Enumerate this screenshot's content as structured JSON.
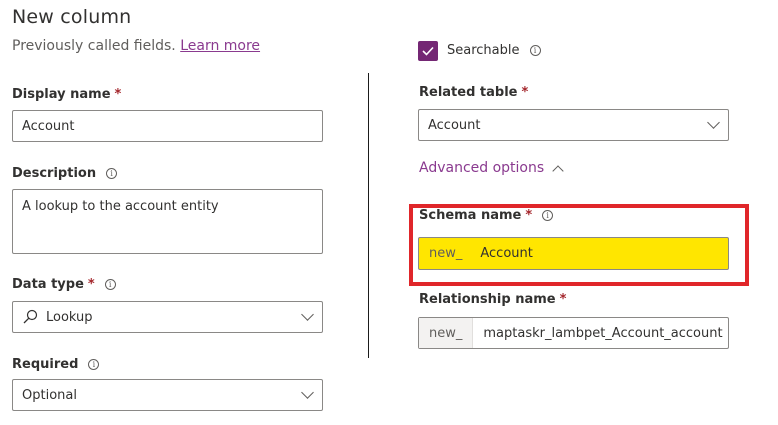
{
  "header": {
    "title": "New column",
    "subtitle": "Previously called fields.",
    "learn_more": "Learn more"
  },
  "display_name": {
    "label": "Display name",
    "required": "*",
    "value": "Account"
  },
  "description": {
    "label": "Description",
    "value": "A lookup to the account entity"
  },
  "data_type": {
    "label": "Data type",
    "required": "*",
    "value": "Lookup",
    "icon": "search-icon"
  },
  "required_field": {
    "label": "Required",
    "value": "Optional"
  },
  "searchable": {
    "label": "Searchable",
    "checked": true
  },
  "related_table": {
    "label": "Related table",
    "required": "*",
    "value": "Account"
  },
  "advanced_options": {
    "label": "Advanced options",
    "expanded": true
  },
  "schema_name": {
    "label": "Schema name",
    "required": "*",
    "prefix": "new_",
    "value": "Account",
    "highlight_color": "#ffe600"
  },
  "relationship_name": {
    "label": "Relationship name",
    "required": "*",
    "prefix": "new_",
    "value": "maptaskr_lambpet_Account_account"
  },
  "info_glyph": "i",
  "colors": {
    "accent": "#742774",
    "link": "#8a3a8f",
    "required": "#a4262c",
    "annotation_box": "#e0262a"
  }
}
